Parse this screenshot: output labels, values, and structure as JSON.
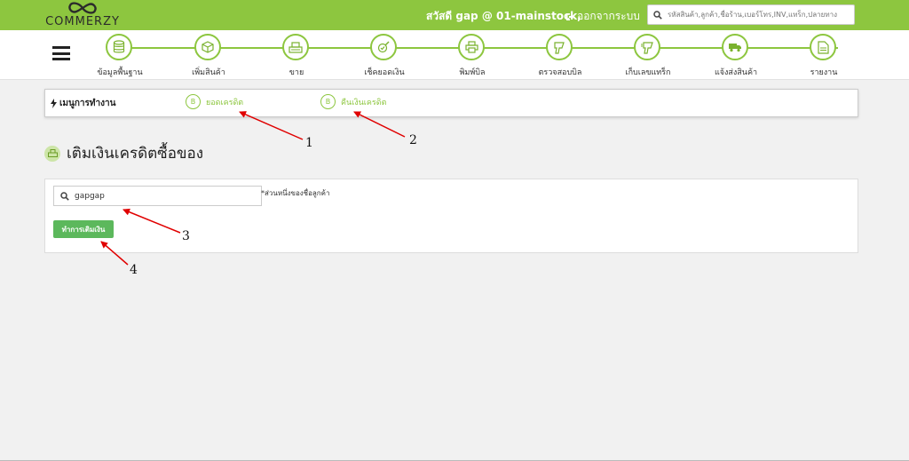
{
  "brand": {
    "name": "COMMERZY",
    "color": "#8dc63f"
  },
  "header": {
    "greeting": "สวัสดี gap @ 01-mainstock,",
    "logout_label": "ออกจากระบบ",
    "search_placeholder": "รหัสสินค้า,ลูกค้า,ชื่อร้าน,เบอร์โทร,INV,แทร็ก,ปลายทาง"
  },
  "nav": {
    "items": [
      {
        "label": "ข้อมูลพื้นฐาน",
        "icon": "database-icon"
      },
      {
        "label": "เพิ่มสินค้า",
        "icon": "box-icon"
      },
      {
        "label": "ขาย",
        "icon": "cash-register-icon"
      },
      {
        "label": "เช็คยอดเงิน",
        "icon": "check-money-icon"
      },
      {
        "label": "พิมพ์บิล",
        "icon": "printer-icon"
      },
      {
        "label": "ตรวจสอบบิล",
        "icon": "scanner-icon"
      },
      {
        "label": "เก็บเลขแทร็ก",
        "icon": "barcode-scanner-icon"
      },
      {
        "label": "แจ้งส่งสินค้า",
        "icon": "truck-icon"
      },
      {
        "label": "รายงาน",
        "icon": "report-icon"
      }
    ]
  },
  "work_menu": {
    "title": "เมนูการทำงาน",
    "links": [
      {
        "label": "ยอดเครดิต"
      },
      {
        "label": "คืนเงินเครดิต"
      }
    ]
  },
  "page": {
    "title": "เติมเงินเครดิตซื้อของ"
  },
  "form": {
    "search_value": "gapgap",
    "hint": "*ส่วนหนึ่งของชื่อลูกค้า",
    "submit_label": "ทำการเติมเงิน"
  },
  "annotations": {
    "labels": [
      "1",
      "2",
      "3",
      "4"
    ],
    "color": "#e00000"
  }
}
